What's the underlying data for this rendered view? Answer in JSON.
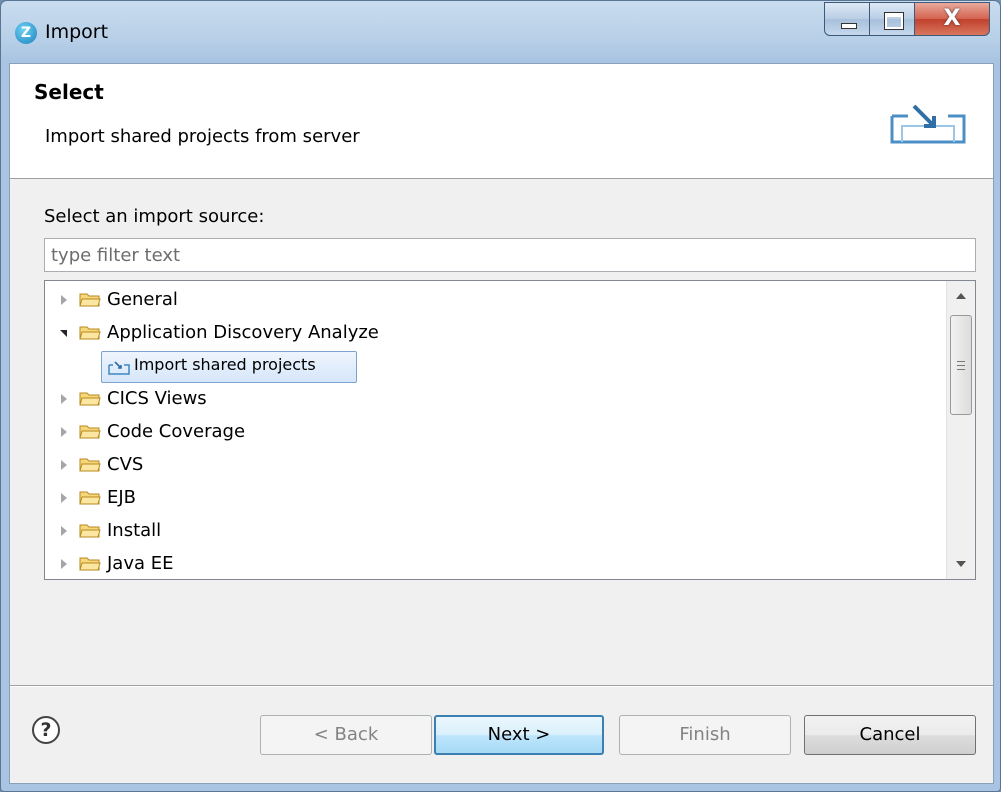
{
  "window": {
    "title": "Import",
    "app_icon_glyph": "Z",
    "close_glyph": "X"
  },
  "header": {
    "title": "Select",
    "description": "Import shared projects from server",
    "banner_icon": "import-wizard-icon"
  },
  "filter": {
    "label": "Select an import source:",
    "placeholder": "type filter text",
    "value": ""
  },
  "tree": {
    "items": [
      {
        "label": "General",
        "expanded": false,
        "icon": "folder-icon"
      },
      {
        "label": "Application Discovery Analyze",
        "expanded": true,
        "icon": "folder-icon"
      },
      {
        "label": "Import shared projects",
        "selected": true,
        "icon": "import-icon"
      },
      {
        "label": "CICS Views",
        "expanded": false,
        "icon": "folder-icon"
      },
      {
        "label": "Code Coverage",
        "expanded": false,
        "icon": "folder-icon"
      },
      {
        "label": "CVS",
        "expanded": false,
        "icon": "folder-icon"
      },
      {
        "label": "EJB",
        "expanded": false,
        "icon": "folder-icon"
      },
      {
        "label": "Install",
        "expanded": false,
        "icon": "folder-icon"
      },
      {
        "label": "Java EE",
        "expanded": false,
        "icon": "folder-icon"
      }
    ]
  },
  "footer": {
    "help_glyph": "?",
    "back_label": "< Back",
    "next_label": "Next >",
    "finish_label": "Finish",
    "cancel_label": "Cancel"
  },
  "colors": {
    "selection_border": "#7da2ce",
    "default_button_border": "#3c7fb1",
    "folder": "#e8b84a"
  }
}
